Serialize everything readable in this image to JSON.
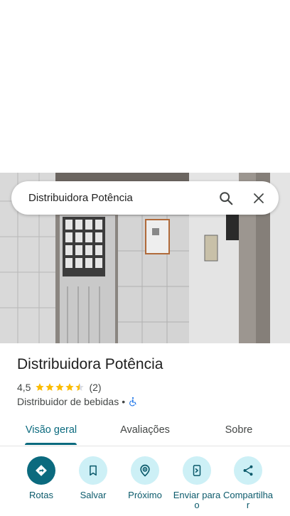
{
  "search": {
    "query": "Distribuidora Potência"
  },
  "place": {
    "title": "Distribuidora Potência",
    "rating": "4,5",
    "rating_value": 4.5,
    "review_count": "(2)",
    "category": "Distribuidor de bebidas",
    "separator": "•"
  },
  "tabs": [
    {
      "label": "Visão geral",
      "active": true
    },
    {
      "label": "Avaliações",
      "active": false
    },
    {
      "label": "Sobre",
      "active": false
    }
  ],
  "actions": [
    {
      "label": "Rotas",
      "icon": "directions-icon"
    },
    {
      "label": "Salvar",
      "icon": "bookmark-icon"
    },
    {
      "label": "Próximo",
      "icon": "nearby-icon"
    },
    {
      "label": "Enviar para o",
      "icon": "send-to-phone-icon"
    },
    {
      "label": "Compartilhar",
      "icon": "share-icon"
    }
  ],
  "colors": {
    "accent": "#0b6a7e",
    "action_bg": "#cdf0f6",
    "star": "#fbbc04",
    "accessibility": "#1a73e8"
  }
}
